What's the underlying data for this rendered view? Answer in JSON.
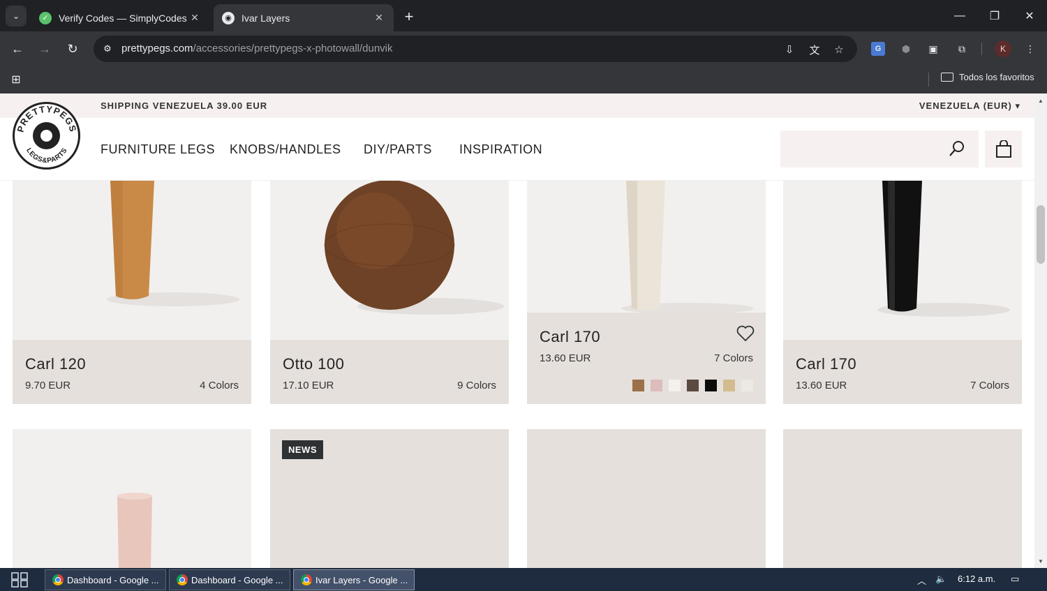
{
  "browser": {
    "tabs": [
      {
        "title": "Verify Codes — SimplyCodes",
        "active": false
      },
      {
        "title": "Ivar Layers",
        "active": true
      }
    ],
    "url_host": "prettypegs.com",
    "url_path": "/accessories/prettypegs-x-photowall/dunvik",
    "profile_initial": "K",
    "bookmarks_all_label": "Todos los favoritos"
  },
  "site": {
    "announcement": "SHIPPING VENEZUELA 39.00 EUR",
    "region": "VENEZUELA (EUR)",
    "logo_top": "PRETTYPEGS",
    "logo_bottom": "LEGS&PARTS",
    "nav": [
      "FURNITURE LEGS",
      "KNOBS/HANDLES",
      "DIY/PARTS",
      "INSPIRATION"
    ]
  },
  "products": [
    {
      "name": "Carl 120",
      "price": "9.70 EUR",
      "colors": "4 Colors"
    },
    {
      "name": "Otto 100",
      "price": "17.10 EUR",
      "colors": "9 Colors"
    },
    {
      "name": "Carl 170",
      "price": "13.60 EUR",
      "colors": "7 Colors",
      "hovered": true,
      "swatches": [
        "#9c7048",
        "#dcbcbc",
        "#f4f1ec",
        "#5a4a40",
        "#0b0b0b",
        "#d2bc8e",
        "#ece8e2"
      ]
    },
    {
      "name": "Carl 170",
      "price": "13.60 EUR",
      "colors": "7 Colors"
    }
  ],
  "second_row": {
    "badge": "NEWS"
  },
  "taskbar": {
    "tasks": [
      "Dashboard - Google ...",
      "Dashboard - Google ...",
      "Ivar Layers - Google ..."
    ],
    "clock": "6:12 a.m."
  }
}
